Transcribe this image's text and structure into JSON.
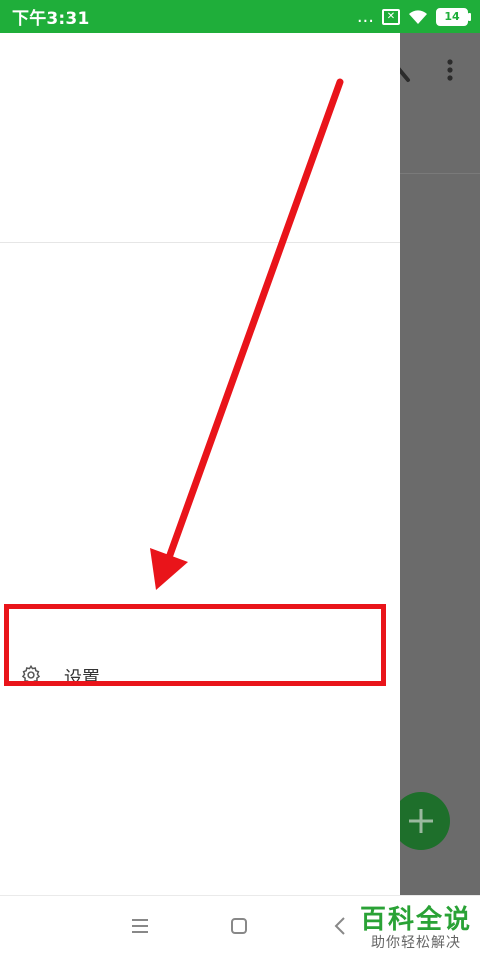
{
  "status_bar": {
    "time": "下午3:31",
    "dots": "...",
    "sim_icon": "x-box-icon",
    "wifi_icon": "wifi-icon",
    "battery": "14"
  },
  "drawer": {
    "settings_label": "设置",
    "settings_icon": "gear-icon"
  },
  "app": {
    "search_icon": "search-icon",
    "more_icon": "more-vert-icon",
    "fab_icon": "plus-icon"
  },
  "annotation": {
    "color": "#e9141a"
  },
  "nav_bar": {
    "menu_icon": "menu-icon",
    "home_icon": "home-icon",
    "back_icon": "back-icon"
  },
  "watermark": {
    "title": "百科全说",
    "subtitle": "助你轻松解决"
  },
  "colors": {
    "status_green": "#1fae3a",
    "dim_overlay": "#6b6b6b",
    "fab_green": "#1e6f2b",
    "watermark_green": "#2aa236"
  }
}
